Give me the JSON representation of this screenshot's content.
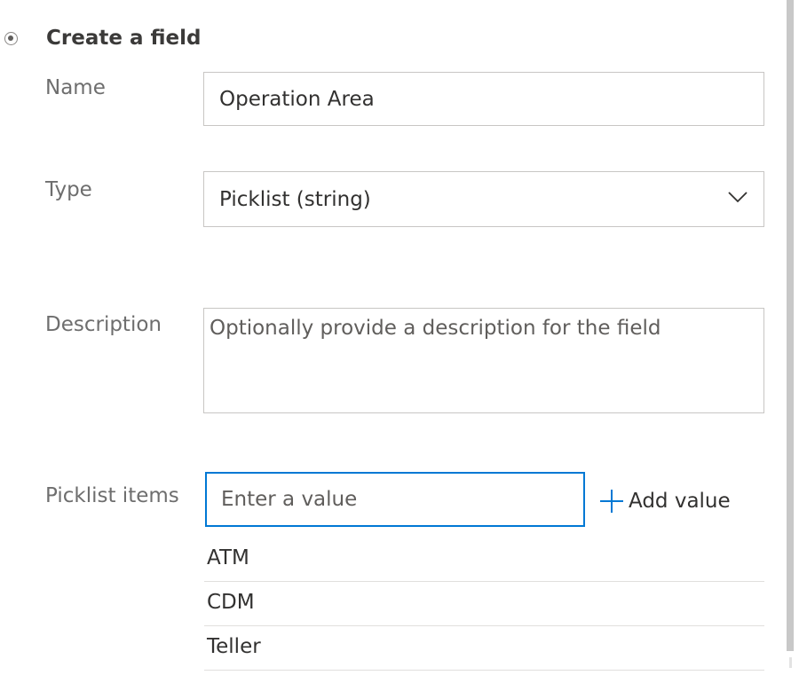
{
  "section": {
    "title": "Create a field",
    "selected": true
  },
  "fields": {
    "name": {
      "label": "Name",
      "value": "Operation Area"
    },
    "type": {
      "label": "Type",
      "selected_value": "Picklist (string)",
      "icon": "chevron-down-icon"
    },
    "description": {
      "label": "Description",
      "placeholder": "Optionally provide a description for the field",
      "value": ""
    },
    "picklist": {
      "label": "Picklist items",
      "placeholder": "Enter a value",
      "value": "",
      "add_label": "Add value",
      "add_icon": "plus-icon",
      "items": [
        "ATM",
        "CDM",
        "Teller"
      ]
    }
  },
  "colors": {
    "accent": "#0078d4",
    "border": "#c8c6c4",
    "label": "#6e6e6e",
    "text": "#323130"
  }
}
